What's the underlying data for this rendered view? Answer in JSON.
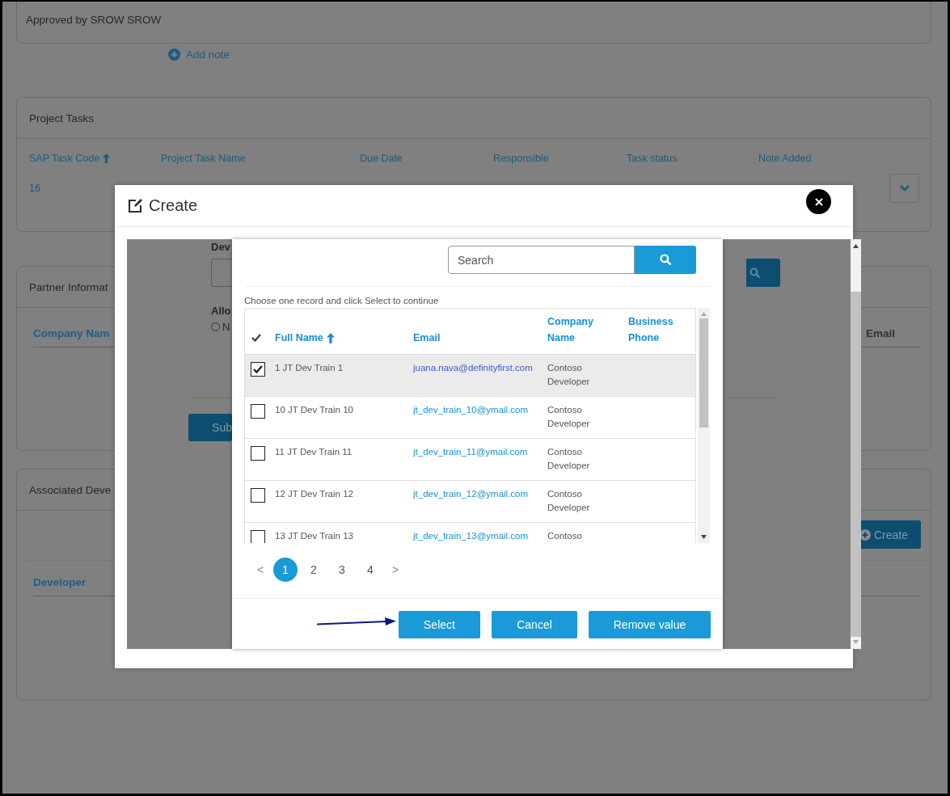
{
  "approval": {
    "text": "Approved by SROW SROW"
  },
  "add_note": {
    "label": "Add note"
  },
  "project_tasks": {
    "title": "Project Tasks",
    "columns": [
      {
        "label": "SAP Task Code",
        "sorted": true
      },
      {
        "label": "Project Task Name",
        "sorted": false
      },
      {
        "label": "Due Date",
        "sorted": false
      },
      {
        "label": "Responsible",
        "sorted": false
      },
      {
        "label": "Task status",
        "sorted": false
      },
      {
        "label": "Note Added",
        "sorted": false
      }
    ],
    "rows": [
      {
        "cells": [
          "16"
        ]
      }
    ]
  },
  "partner_information": {
    "title": "Partner Informat",
    "columns": [
      "Company Nam",
      "Email"
    ]
  },
  "associated_developers": {
    "title": "Associated Deve",
    "create_button": "Create",
    "columns": [
      "Developer"
    ]
  },
  "modal": {
    "title": "Create",
    "form": {
      "developer_label": "Dev",
      "allow_label": "Allo",
      "radio_option": {
        "label": "N",
        "selected": false
      },
      "submit_button": "Sub"
    },
    "lookup": {
      "search": {
        "placeholder": "Search"
      },
      "instruction": "Choose one record and click Select to continue",
      "columns": [
        {
          "label": "Full Name",
          "sorted": true
        },
        {
          "label": "Email",
          "sorted": false
        },
        {
          "label": "Company Name",
          "sorted": false
        },
        {
          "label": "Business Phone",
          "sorted": false
        }
      ],
      "rows": [
        {
          "full_name": "1 JT Dev Train 1",
          "email": "juana.nava@definityfirst.com",
          "company": "Contoso Developer",
          "selected": true
        },
        {
          "full_name": "10 JT Dev Train 10",
          "email": "jt_dev_train_10@ymail.com",
          "company": "Contoso Developer",
          "selected": false
        },
        {
          "full_name": "11 JT Dev Train 11",
          "email": "jt_dev_train_11@ymail.com",
          "company": "Contoso Developer",
          "selected": false
        },
        {
          "full_name": "12 JT Dev Train 12",
          "email": "jt_dev_train_12@ymail.com",
          "company": "Contoso Developer",
          "selected": false
        },
        {
          "full_name": "13 JT Dev Train 13",
          "email": "jt_dev_train_13@ymail.com",
          "company": "Contoso",
          "selected": false
        }
      ],
      "pager": {
        "prev": "<",
        "next": ">",
        "pages": [
          {
            "label": "1",
            "selected": true
          },
          {
            "label": "2",
            "selected": false
          },
          {
            "label": "3",
            "selected": false
          },
          {
            "label": "4",
            "selected": false
          }
        ]
      },
      "buttons": [
        "Select",
        "Cancel",
        "Remove value"
      ]
    }
  }
}
